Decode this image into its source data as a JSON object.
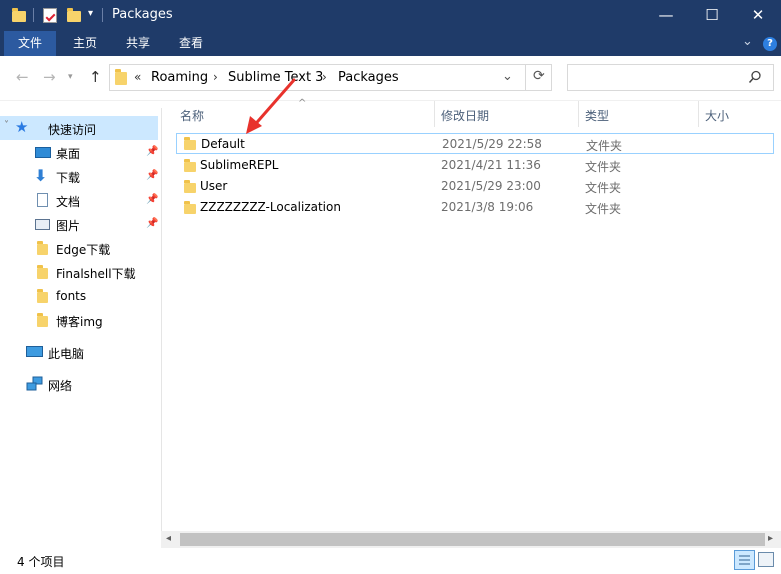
{
  "window": {
    "title": "Packages",
    "buttons": {
      "minimize": "—",
      "maximize": "☐",
      "close": "✕"
    }
  },
  "ribbon": {
    "tabs": [
      "文件",
      "主页",
      "共享",
      "查看"
    ],
    "expand_glyph": "⌄",
    "help_glyph": "?"
  },
  "address": {
    "overflow": "«",
    "crumbs": [
      "Roaming",
      "Sublime Text 3",
      "Packages"
    ],
    "dropdown_glyph": "⌄",
    "refresh_glyph": "⟳"
  },
  "search": {
    "placeholder": ""
  },
  "nav": {
    "quick_access": "快速访问",
    "items": [
      {
        "label": "桌面",
        "icon": "desktop-icon",
        "pinned": true
      },
      {
        "label": "下载",
        "icon": "download-icon",
        "pinned": true
      },
      {
        "label": "文档",
        "icon": "document-icon",
        "pinned": true
      },
      {
        "label": "图片",
        "icon": "picture-icon",
        "pinned": true
      },
      {
        "label": "Edge下载",
        "icon": "folder-icon",
        "pinned": false
      },
      {
        "label": "Finalshell下载",
        "icon": "folder-icon",
        "pinned": false
      },
      {
        "label": "fonts",
        "icon": "folder-icon",
        "pinned": false
      },
      {
        "label": "博客img",
        "icon": "folder-icon",
        "pinned": false
      }
    ],
    "this_pc": "此电脑",
    "network": "网络"
  },
  "columns": {
    "name": "名称",
    "date": "修改日期",
    "type": "类型",
    "size": "大小"
  },
  "files": [
    {
      "name": "Default",
      "date": "2021/5/29 22:58",
      "type": "文件夹"
    },
    {
      "name": "SublimeREPL",
      "date": "2021/4/21 11:36",
      "type": "文件夹"
    },
    {
      "name": "User",
      "date": "2021/5/29 23:00",
      "type": "文件夹"
    },
    {
      "name": "ZZZZZZZZ-Localization",
      "date": "2021/3/8 19:06",
      "type": "文件夹"
    }
  ],
  "status": {
    "item_count": "4 个项目"
  },
  "colors": {
    "titlebar": "#1f3b69",
    "selected_nav": "#cce8ff",
    "hover_row_border": "#99d1ff",
    "annotation_arrow": "#e8322c"
  }
}
